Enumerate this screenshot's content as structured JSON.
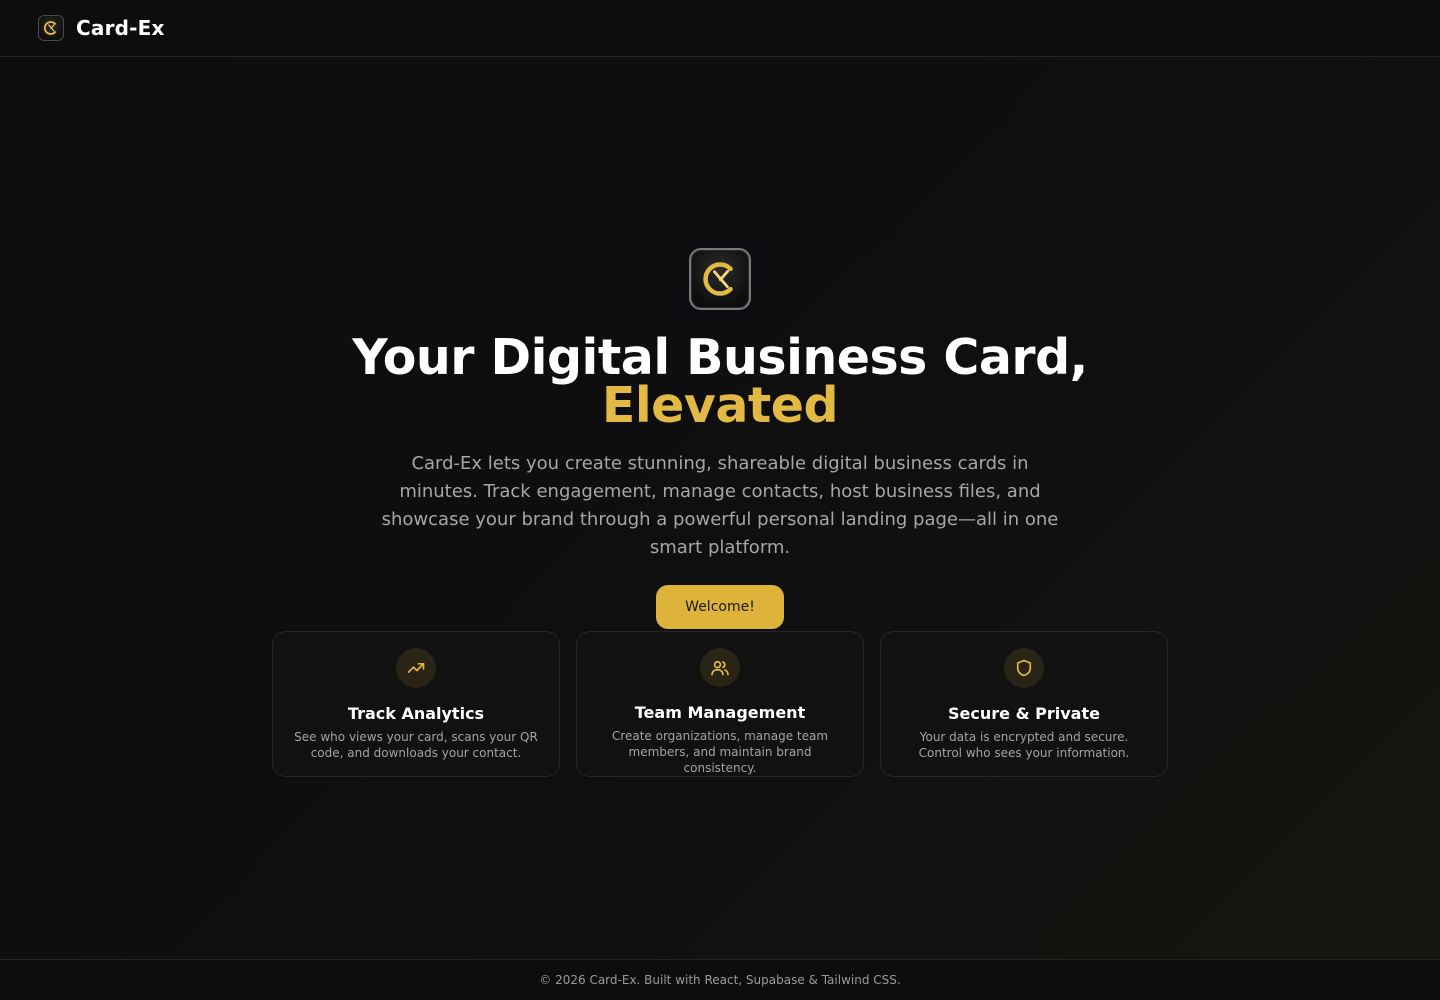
{
  "header": {
    "brand_name": "Card-Ex",
    "logo_icon": "card-ex-logo-icon"
  },
  "hero": {
    "title_line1": "Your Digital Business Card,",
    "title_line2": "Elevated",
    "description": "Card-Ex lets you create stunning, shareable digital business cards in minutes. Track engagement, manage contacts, host business files, and showcase your brand through a powerful personal landing page—all in one smart platform.",
    "cta_label": "Welcome!"
  },
  "features": [
    {
      "icon": "trending-up-icon",
      "title": "Track Analytics",
      "text": "See who views your card, scans your QR code, and downloads your contact."
    },
    {
      "icon": "users-icon",
      "title": "Team Management",
      "text": "Create organizations, manage team members, and maintain brand consistency."
    },
    {
      "icon": "shield-icon",
      "title": "Secure & Private",
      "text": "Your data is encrypted and secure. Control who sees your information."
    }
  ],
  "footer": {
    "text": "© 2026 Card-Ex. Built with React, Supabase & Tailwind CSS."
  },
  "colors": {
    "accent": "#e2b945",
    "button": "#ddb33a",
    "background": "#0f0f10",
    "card": "#111112"
  }
}
